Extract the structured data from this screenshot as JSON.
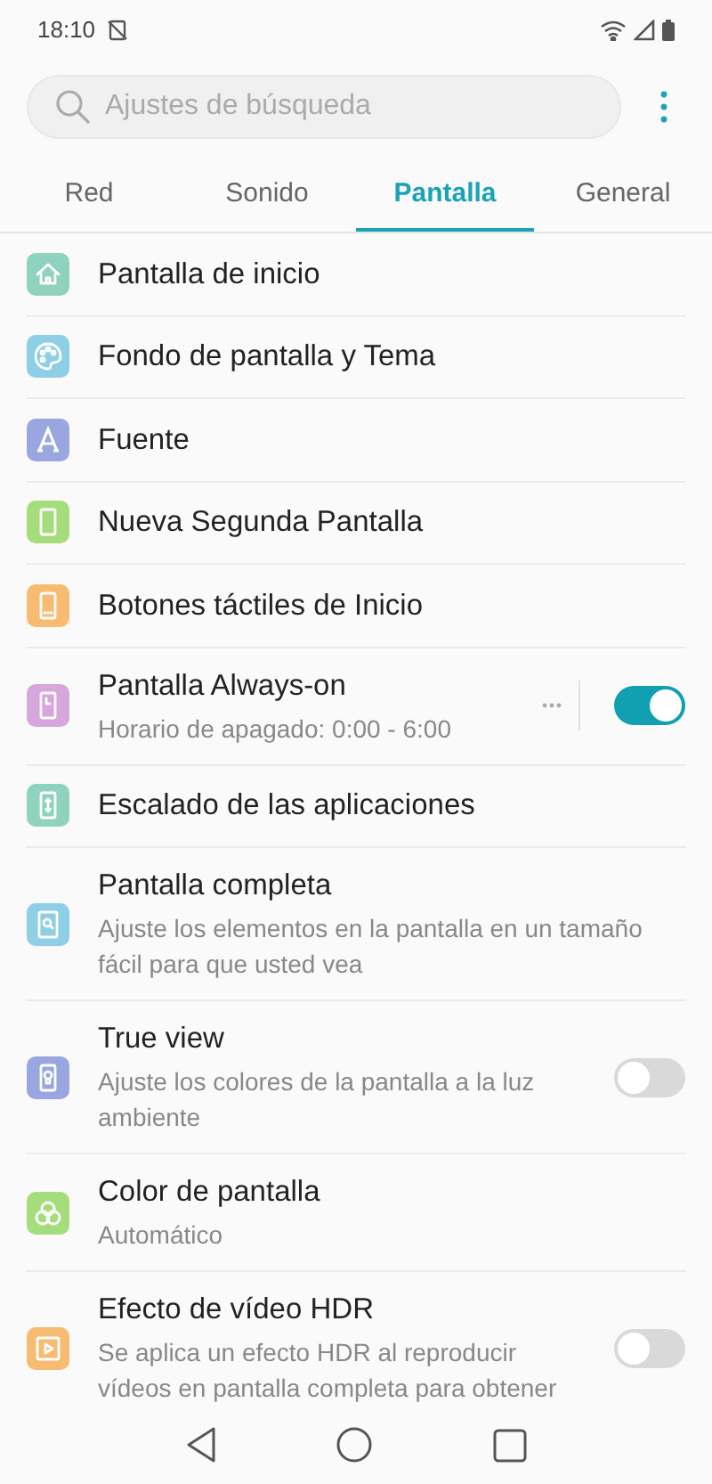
{
  "status_bar": {
    "time": "18:10"
  },
  "search": {
    "placeholder": "Ajustes de búsqueda"
  },
  "tabs": [
    {
      "label": "Red",
      "selected": false
    },
    {
      "label": "Sonido",
      "selected": false
    },
    {
      "label": "Pantalla",
      "selected": true
    },
    {
      "label": "General",
      "selected": false
    }
  ],
  "items": [
    {
      "color": "#8fd3be",
      "title": "Pantalla de inicio"
    },
    {
      "color": "#8ecfe6",
      "title": "Fondo de pantalla y Tema"
    },
    {
      "color": "#9aa6e0",
      "title": "Fuente"
    },
    {
      "color": "#a6dd7c",
      "title": "Nueva Segunda Pantalla"
    },
    {
      "color": "#f8bb72",
      "title": "Botones táctiles de Inicio"
    },
    {
      "color": "#d6a6dd",
      "title": "Pantalla Always-on",
      "subtitle": "Horario de apagado: 0:00 - 6:00",
      "more": true,
      "toggle": {
        "on": true
      }
    },
    {
      "color": "#8fd3be",
      "title": "Escalado de las aplicaciones"
    },
    {
      "color": "#8ecfe6",
      "title": "Pantalla completa",
      "subtitle": "Ajuste los elementos en la pantalla en un tamaño fácil para que usted vea"
    },
    {
      "color": "#9aa6e0",
      "title": "True view",
      "subtitle": "Ajuste los colores de la pantalla a la luz ambiente",
      "toggle": {
        "on": false
      }
    },
    {
      "color": "#a6dd7c",
      "title": "Color de pantalla",
      "subtitle": "Automático"
    },
    {
      "color": "#f8bb72",
      "title": "Efecto de vídeo HDR",
      "subtitle": "Se aplica un efecto HDR al reproducir vídeos en pantalla completa para obtener",
      "toggle": {
        "on": false
      }
    }
  ]
}
